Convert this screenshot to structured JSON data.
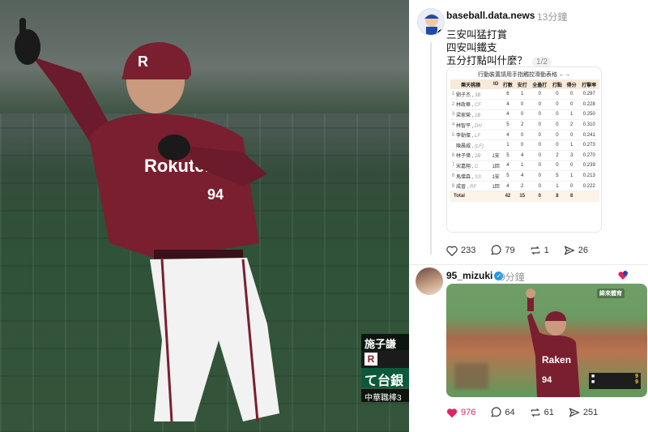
{
  "photo": {
    "overlay": {
      "player_name": "施子謙",
      "team_a": "R",
      "team_b": "て台銀",
      "league": "中華職棒3"
    },
    "jersey_text": "Rokuten",
    "jersey_number": "94"
  },
  "post1": {
    "username": "baseball.data.news",
    "time": "13分鐘",
    "lines": [
      "三安叫猛打賞",
      "四安叫鐵支",
      "五分打點叫什麼？"
    ],
    "page_indicator": "1/2",
    "table": {
      "hint": "行動裝置請用手指觸控滑動表格 ←",
      "headers": [
        "樂天桃猿",
        "IO",
        "打數",
        "安打",
        "全壘打",
        "打點",
        "得分",
        "打擊率"
      ],
      "rows": [
        {
          "no": "1",
          "name": "劉子杰",
          "pos": "3B",
          "io": "",
          "ab": "6",
          "h": "1",
          "hr": "0",
          "rbi": "0",
          "r": "0",
          "avg": "0.297"
        },
        {
          "no": "2",
          "name": "林政華",
          "pos": "CF",
          "io": "",
          "ab": "4",
          "h": "0",
          "hr": "0",
          "rbi": "0",
          "r": "0",
          "avg": "0.228"
        },
        {
          "no": "3",
          "name": "梁家榮",
          "pos": "1B",
          "io": "",
          "ab": "4",
          "h": "0",
          "hr": "0",
          "rbi": "0",
          "r": "1",
          "avg": "0.250"
        },
        {
          "no": "4",
          "name": "林智平",
          "pos": "DH",
          "io": "",
          "ab": "5",
          "h": "2",
          "hr": "0",
          "rbi": "0",
          "r": "2",
          "avg": "0.310"
        },
        {
          "no": "5",
          "name": "李勛傑",
          "pos": "LF",
          "io": "",
          "ab": "4",
          "h": "0",
          "hr": "0",
          "rbi": "0",
          "r": "0",
          "avg": "0.241"
        },
        {
          "no": "",
          "name": "陳晨威",
          "pos": "(LF)",
          "io": "",
          "ab": "1",
          "h": "0",
          "hr": "0",
          "rbi": "0",
          "r": "1",
          "avg": "0.273"
        },
        {
          "no": "6",
          "name": "林子偉",
          "pos": "2B",
          "io": "1安",
          "ab": "5",
          "h": "4",
          "hr": "0",
          "rbi": "2",
          "r": "3",
          "avg": "0.270"
        },
        {
          "no": "7",
          "name": "宋嘉翔",
          "pos": "C",
          "io": "1回",
          "ab": "4",
          "h": "1",
          "hr": "0",
          "rbi": "0",
          "r": "0",
          "avg": "0.239"
        },
        {
          "no": "8",
          "name": "馬傑森",
          "pos": "SS",
          "io": "1安",
          "ab": "5",
          "h": "4",
          "hr": "0",
          "rbi": "5",
          "r": "1",
          "avg": "0.213"
        },
        {
          "no": "9",
          "name": "成晉",
          "pos": "RF",
          "io": "1回",
          "ab": "4",
          "h": "2",
          "hr": "0",
          "rbi": "1",
          "r": "0",
          "avg": "0.222"
        }
      ],
      "total": {
        "label": "Total",
        "ab": "42",
        "h": "15",
        "hr": "0",
        "rbi": "8",
        "r": "8"
      }
    },
    "actions": {
      "likes": "233",
      "comments": "79",
      "reposts": "1",
      "shares": "26"
    }
  },
  "post2": {
    "username": "95_mizuki",
    "time": "9分鐘",
    "video": {
      "channel_logo": "緯來體育",
      "scorebug_home": "9",
      "scorebug_away": "9",
      "jersey_text": "Raken",
      "jersey_number": "94"
    },
    "actions": {
      "likes": "976",
      "comments": "64",
      "reposts": "61",
      "shares": "251"
    }
  },
  "colors": {
    "like_red": "#e0245e",
    "table_header": "#f7ead9",
    "jersey": "#7a1f30"
  }
}
